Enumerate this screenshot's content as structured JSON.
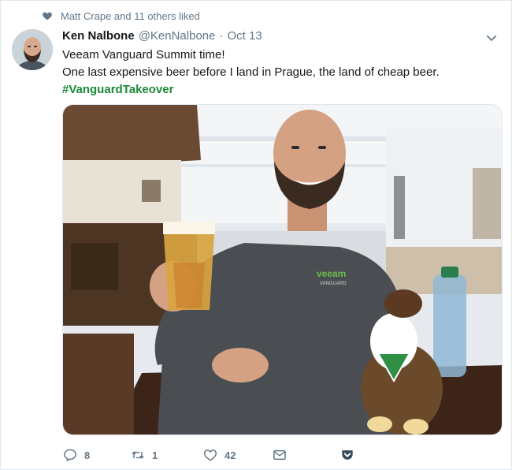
{
  "social_context": {
    "text": "Matt Crape and 11 others liked"
  },
  "tweet": {
    "name": "Ken Nalbone",
    "handle": "@KenNalbone",
    "separator": "·",
    "date": "Oct 13",
    "lines": [
      "Veeam Vanguard Summit time!",
      "One last expensive beer before I land in Prague, the land of cheap beer."
    ],
    "hashtag": "#VanguardTakeover"
  },
  "actions": {
    "reply_count": "8",
    "retweet_count": "1",
    "like_count": "42"
  },
  "media": {
    "jacket_brand": "veeam",
    "jacket_sub": "VANGUARD"
  },
  "colors": {
    "hashtag": "#1b8a3a",
    "secondary_text": "#657786",
    "pocket": "#3b4a5c"
  }
}
